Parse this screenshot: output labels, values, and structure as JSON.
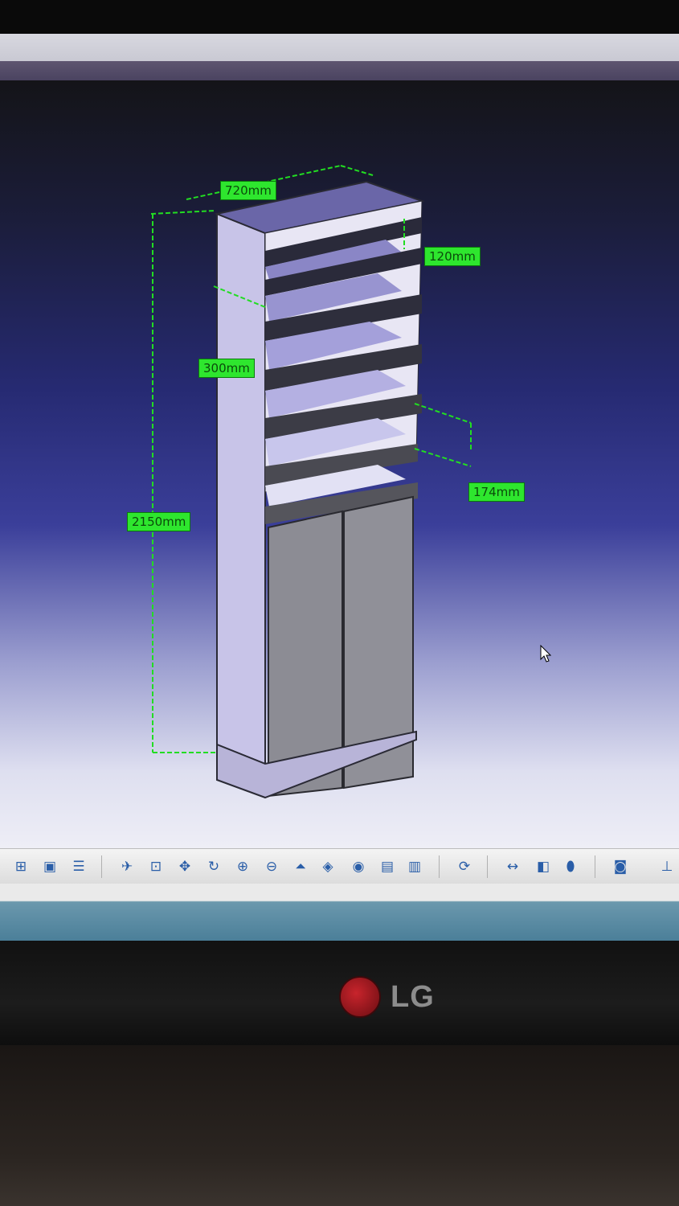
{
  "dimensions": {
    "width": "720mm",
    "shelf_gap": "120mm",
    "depth": "300mm",
    "height": "2150mm",
    "lower_gap": "174mm"
  },
  "colors": {
    "dimension_green": "#2ee62e",
    "viewport_top": "#141418",
    "viewport_mid": "#3b3f9a",
    "viewport_bottom": "#eeeef6",
    "cabinet_side": "#c8c4e8",
    "cabinet_door": "#8a8a92"
  },
  "toolbar": {
    "buttons": [
      "tree-icon",
      "lock-icon",
      "properties-icon",
      "fly-icon",
      "fit-all-icon",
      "pan-icon",
      "rotate-icon",
      "zoom-in-icon",
      "zoom-out-icon",
      "normal-view-icon",
      "iso-view-icon",
      "render-style-icon",
      "hide-show-icon",
      "swap-space-icon",
      "update-icon",
      "measure-icon",
      "analysis-icon",
      "mass-icon",
      "capture-icon",
      "axis-icon"
    ]
  },
  "monitor": {
    "brand": "LG"
  }
}
